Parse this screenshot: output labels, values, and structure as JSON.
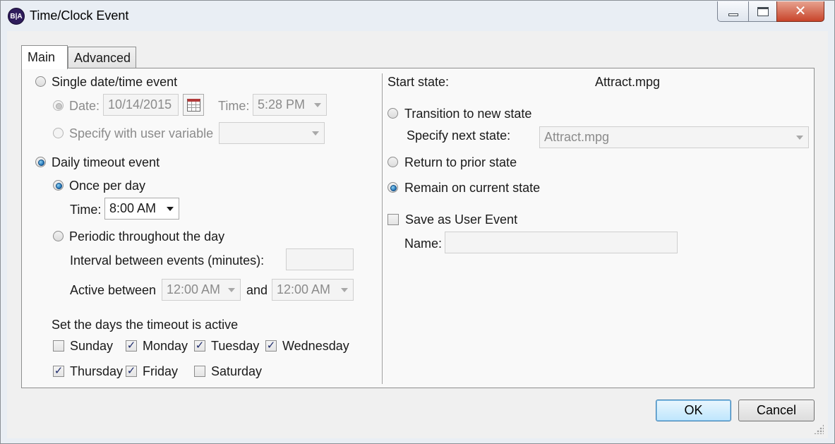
{
  "window": {
    "title": "Time/Clock Event",
    "app_icon_text": "B|A",
    "controls": {
      "minimize": "minimize-icon",
      "maximize": "maximize-icon",
      "close": "close-icon"
    }
  },
  "tabs": [
    {
      "label": "Main",
      "selected": true
    },
    {
      "label": "Advanced",
      "selected": false
    }
  ],
  "left": {
    "single_event": {
      "label": "Single date/time event",
      "selected": false,
      "date_radio_label": "Date:",
      "date_value": "10/14/2015",
      "calendar_icon": "calendar-icon",
      "time_label": "Time:",
      "time_value": "5:28 PM",
      "user_variable_label": "Specify with user variable",
      "user_variable_value": ""
    },
    "daily_event": {
      "label": "Daily timeout event",
      "selected": true,
      "once_per_day_label": "Once per day",
      "once_per_day_selected": true,
      "time_label": "Time:",
      "time_value": "8:00 AM",
      "periodic_label": "Periodic throughout the day",
      "periodic_selected": false,
      "interval_label": "Interval between events (minutes):",
      "interval_value": "",
      "active_between_label": "Active between",
      "active_from": "12:00 AM",
      "and_label": "and",
      "active_to": "12:00 AM"
    },
    "days": {
      "heading": "Set the days the timeout is active",
      "items": [
        {
          "label": "Sunday",
          "checked": false
        },
        {
          "label": "Monday",
          "checked": true
        },
        {
          "label": "Tuesday",
          "checked": true
        },
        {
          "label": "Wednesday",
          "checked": true
        },
        {
          "label": "Thursday",
          "checked": true
        },
        {
          "label": "Friday",
          "checked": true
        },
        {
          "label": "Saturday",
          "checked": false
        }
      ]
    }
  },
  "right": {
    "start_state_label": "Start state:",
    "start_state_value": "Attract.mpg",
    "transition_label": "Transition to new state",
    "transition_selected": false,
    "next_state_label": "Specify next state:",
    "next_state_value": "Attract.mpg",
    "return_label": "Return to prior state",
    "return_selected": false,
    "remain_label": "Remain on current state",
    "remain_selected": true,
    "save_user_event_label": "Save as User Event",
    "save_user_event_checked": false,
    "name_label": "Name:",
    "name_value": ""
  },
  "footer": {
    "ok_label": "OK",
    "cancel_label": "Cancel"
  }
}
